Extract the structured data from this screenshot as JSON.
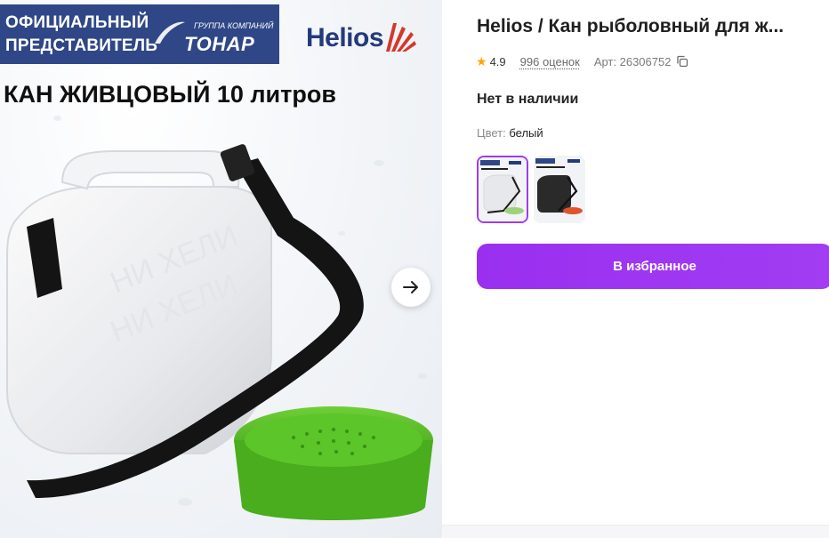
{
  "gallery": {
    "banner": {
      "line1": "ОФИЦИАЛЬНЫЙ",
      "line2": "ПРЕДСТАВИТЕЛЬ",
      "group_label": "ГРУППА КОМПАНИЙ",
      "brand": "ТОНАР"
    },
    "logo_text": "Helios",
    "image_title": "КАН ЖИВЦОВЫЙ 10 литров",
    "next_icon": "arrow-right-icon"
  },
  "product": {
    "title": "Helios / Кан рыболовный для ж...",
    "rating": "4.9",
    "reviews": "996 оценок",
    "article": "Арт: 26306752",
    "availability": "Нет в наличии",
    "color_label": "Цвет:",
    "color_value": "белый",
    "favorite_button": "В избранное"
  },
  "colors": {
    "accent": "#9d33f2",
    "star": "#ffa600",
    "banner": "#2f4787",
    "basket_green": "#4caf1e"
  }
}
